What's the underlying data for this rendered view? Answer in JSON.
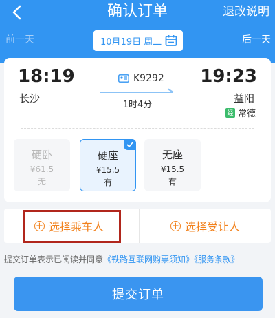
{
  "header": {
    "title": "确认订单",
    "policy_link": "退改说明",
    "accent": "#3295f2"
  },
  "day_nav": {
    "prev": "前一天",
    "next": "后一天",
    "date": "10月19日 周二"
  },
  "trip": {
    "depart_time": "18:19",
    "depart_station": "长沙",
    "arrive_time": "19:23",
    "arrive_station": "益阳",
    "via_badge": "经",
    "via_station": "常德",
    "train_no": "K9292",
    "duration": "1时4分"
  },
  "seats": [
    {
      "name": "硬卧",
      "price": "¥61.5",
      "avail": "无",
      "state": "disabled"
    },
    {
      "name": "硬座",
      "price": "¥15.5",
      "avail": "有",
      "state": "selected"
    },
    {
      "name": "无座",
      "price": "¥15.5",
      "avail": "有",
      "state": "normal"
    }
  ],
  "passengers": {
    "choose_passenger": "选择乘车人",
    "choose_beneficiary": "选择受让人",
    "accent": "#f2821d"
  },
  "agreement": {
    "prefix": "提交订单表示已阅读并同意",
    "link1": "《铁路互联网购票须知》",
    "link2": "《服务条款》"
  },
  "submit_label": "提交订单"
}
